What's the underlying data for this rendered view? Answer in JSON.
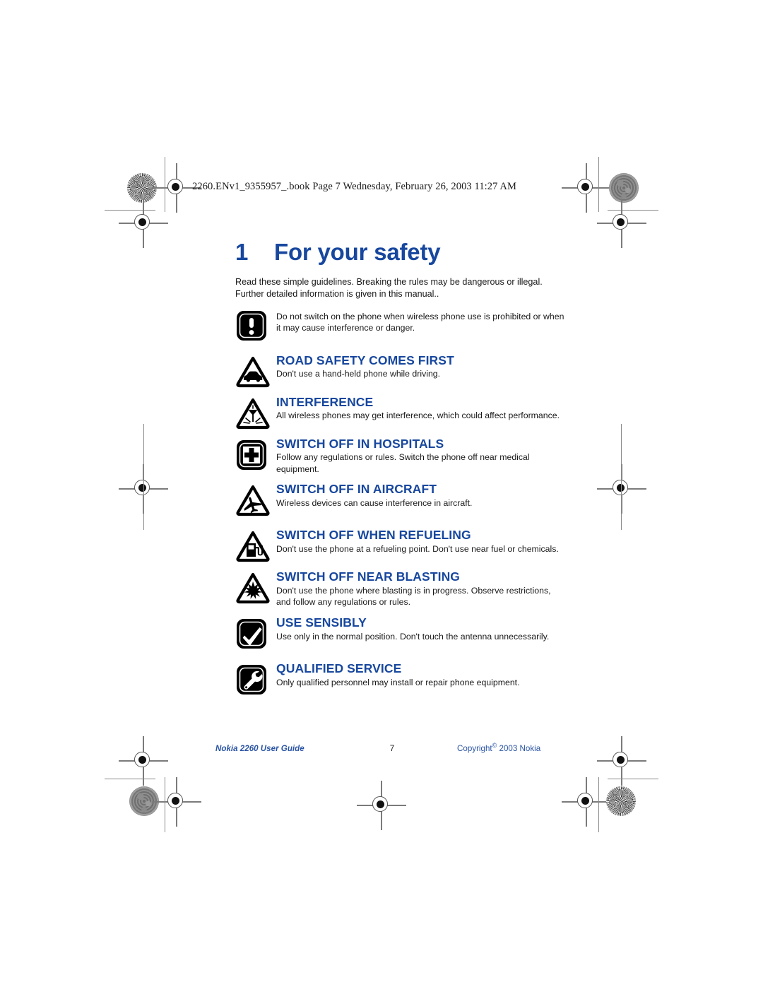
{
  "header": {
    "slug": "2260.ENv1_9355957_.book  Page 7  Wednesday, February 26, 2003  11:27 AM"
  },
  "chapter": {
    "number": "1",
    "title": "For your safety"
  },
  "intro": "Read these simple guidelines. Breaking the rules may be dangerous or illegal. Further detailed information is given in this manual..",
  "items": [
    {
      "icon": "exclamation-mark-icon",
      "heading": "",
      "body": "Do not switch on the phone when wireless phone use is prohibited or when it may cause interference or danger."
    },
    {
      "icon": "car-warning-triangle-icon",
      "heading": "ROAD SAFETY COMES FIRST",
      "body": "Don't use a hand-held phone while driving."
    },
    {
      "icon": "antenna-interference-triangle-icon",
      "heading": "INTERFERENCE",
      "body": "All wireless phones may get interference, which could affect performance."
    },
    {
      "icon": "medical-cross-icon",
      "heading": "SWITCH OFF IN HOSPITALS",
      "body": "Follow any regulations or rules. Switch the phone off near medical equipment."
    },
    {
      "icon": "airplane-warning-triangle-icon",
      "heading": "SWITCH OFF IN AIRCRAFT",
      "body": "Wireless devices can cause interference in aircraft."
    },
    {
      "icon": "fuel-pump-warning-triangle-icon",
      "heading": "SWITCH OFF WHEN REFUELING",
      "body": "Don't use the phone at a refueling point. Don't use near fuel or chemicals."
    },
    {
      "icon": "explosion-warning-triangle-icon",
      "heading": "SWITCH OFF NEAR BLASTING",
      "body": "Don't use the phone where blasting is in progress. Observe restrictions, and follow any regulations or rules."
    },
    {
      "icon": "checkmark-icon",
      "heading": "USE SENSIBLY",
      "body": "Use only in the normal position. Don't touch the antenna unnecessarily."
    },
    {
      "icon": "wrench-icon",
      "heading": "QUALIFIED SERVICE",
      "body": "Only qualified personnel may install or repair phone equipment."
    }
  ],
  "footer": {
    "left": "Nokia 2260 User Guide",
    "page_number": "7",
    "copyright_text": "Copyright",
    "copyright_mark": "©",
    "copyright_year_owner": "2003 Nokia"
  },
  "colors": {
    "heading_blue": "#17479e",
    "footer_blue": "#2a54a4",
    "body_text": "#181818",
    "page_background": "#ffffff"
  }
}
